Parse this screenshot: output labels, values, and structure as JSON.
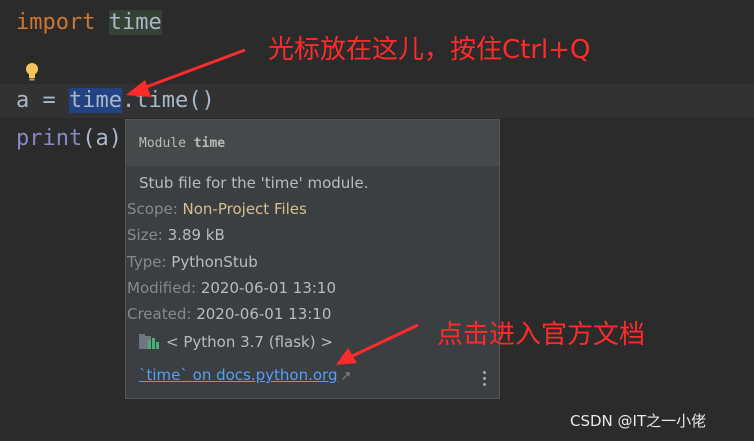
{
  "editor": {
    "line1": {
      "keyword": "import",
      "module": "time"
    },
    "line2": {
      "assign": "a = ",
      "selected": "time",
      "rest": ".time()"
    },
    "line3": {
      "builtin": "print",
      "args": "(a)"
    }
  },
  "doc_popup": {
    "header_prefix": "Module ",
    "header_name": "time",
    "description": "Stub file for the 'time' module.",
    "rows": [
      {
        "key": "Scope:",
        "value": "Non-Project Files"
      },
      {
        "key": "Size:",
        "value": "3.89 kB"
      },
      {
        "key": "Type:",
        "value": "PythonStub"
      },
      {
        "key": "Modified:",
        "value": "2020-06-01 13:10"
      },
      {
        "key": "Created:",
        "value": "2020-06-01 13:10"
      }
    ],
    "environment": "< Python 3.7 (flask) >",
    "link": "`time` on docs.python.org",
    "link_arrow": "↗"
  },
  "annotations": {
    "top": "光标放在这儿，按住Ctrl+Q",
    "bottom": "点击进入官方文档"
  },
  "watermark": "CSDN @IT之一小佬",
  "colors": {
    "background": "#2b2b2b",
    "keyword": "#cc7832",
    "text": "#a9b7c6",
    "selection": "#214283",
    "link": "#589df6",
    "annotation": "#ff2b2b"
  },
  "icons": {
    "bulb": "lightbulb-icon",
    "env": "python-env-icon",
    "external": "external-link-icon",
    "more": "more-vertical-icon"
  }
}
